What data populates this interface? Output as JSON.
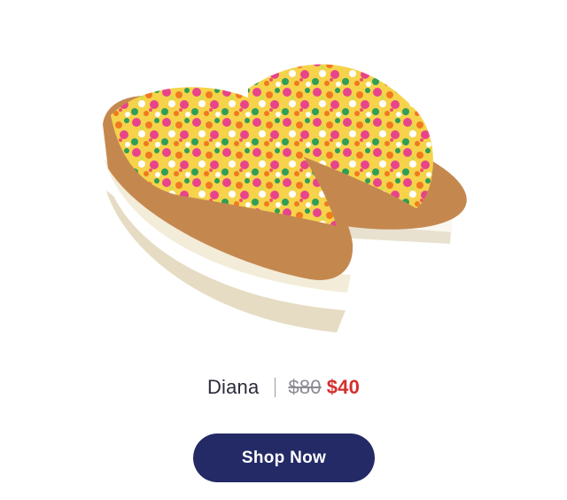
{
  "product": {
    "name": "Diana",
    "original_price": "$80",
    "sale_price": "$40",
    "image": "floral-platform-slide-sandals"
  },
  "cta": {
    "label": "Shop Now"
  },
  "colors": {
    "button_bg": "#232a66",
    "sale_price": "#d3302e",
    "text": "#2b2b3a"
  }
}
